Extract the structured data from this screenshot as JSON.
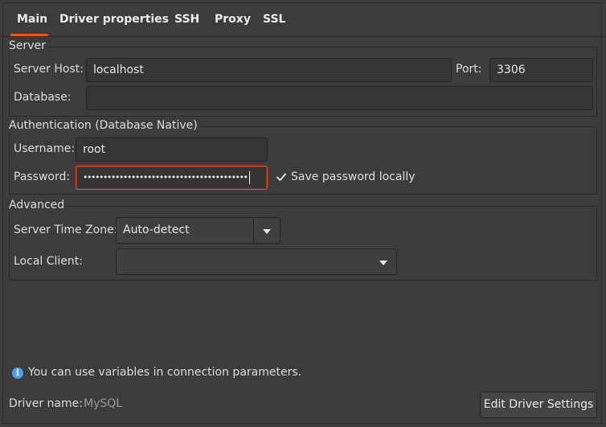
{
  "tabs": [
    {
      "label": "Main",
      "active": true
    },
    {
      "label": "Driver properties"
    },
    {
      "label": "SSH"
    },
    {
      "label": "Proxy"
    },
    {
      "label": "SSL"
    }
  ],
  "server": {
    "title": "Server",
    "host_label": "Server Host:",
    "host_value": "localhost",
    "port_label": "Port:",
    "port_value": "3306",
    "database_label": "Database:",
    "database_value": ""
  },
  "auth": {
    "title": "Authentication (Database Native)",
    "username_label": "Username:",
    "username_value": "root",
    "password_label": "Password:",
    "password_mask": "•••••••••••••••••••••••••••••••••••••••••",
    "save_password_label": "Save password locally",
    "save_password_checked": true
  },
  "advanced": {
    "title": "Advanced",
    "timezone_label": "Server Time Zone:",
    "timezone_value": "Auto-detect",
    "local_client_label": "Local Client:",
    "local_client_value": ""
  },
  "footer": {
    "info_text": "You can use variables in connection parameters.",
    "driver_name_label": "Driver name:",
    "driver_name_value": "MySQL",
    "edit_driver_button": "Edit Driver Settings"
  },
  "colors": {
    "accent": "#e95420",
    "info": "#4a9fe6",
    "background": "#3c3c3c"
  },
  "icons": {
    "info": "info-icon",
    "checkbox": "checkmark-icon",
    "dropdown": "chevron-down-icon"
  }
}
